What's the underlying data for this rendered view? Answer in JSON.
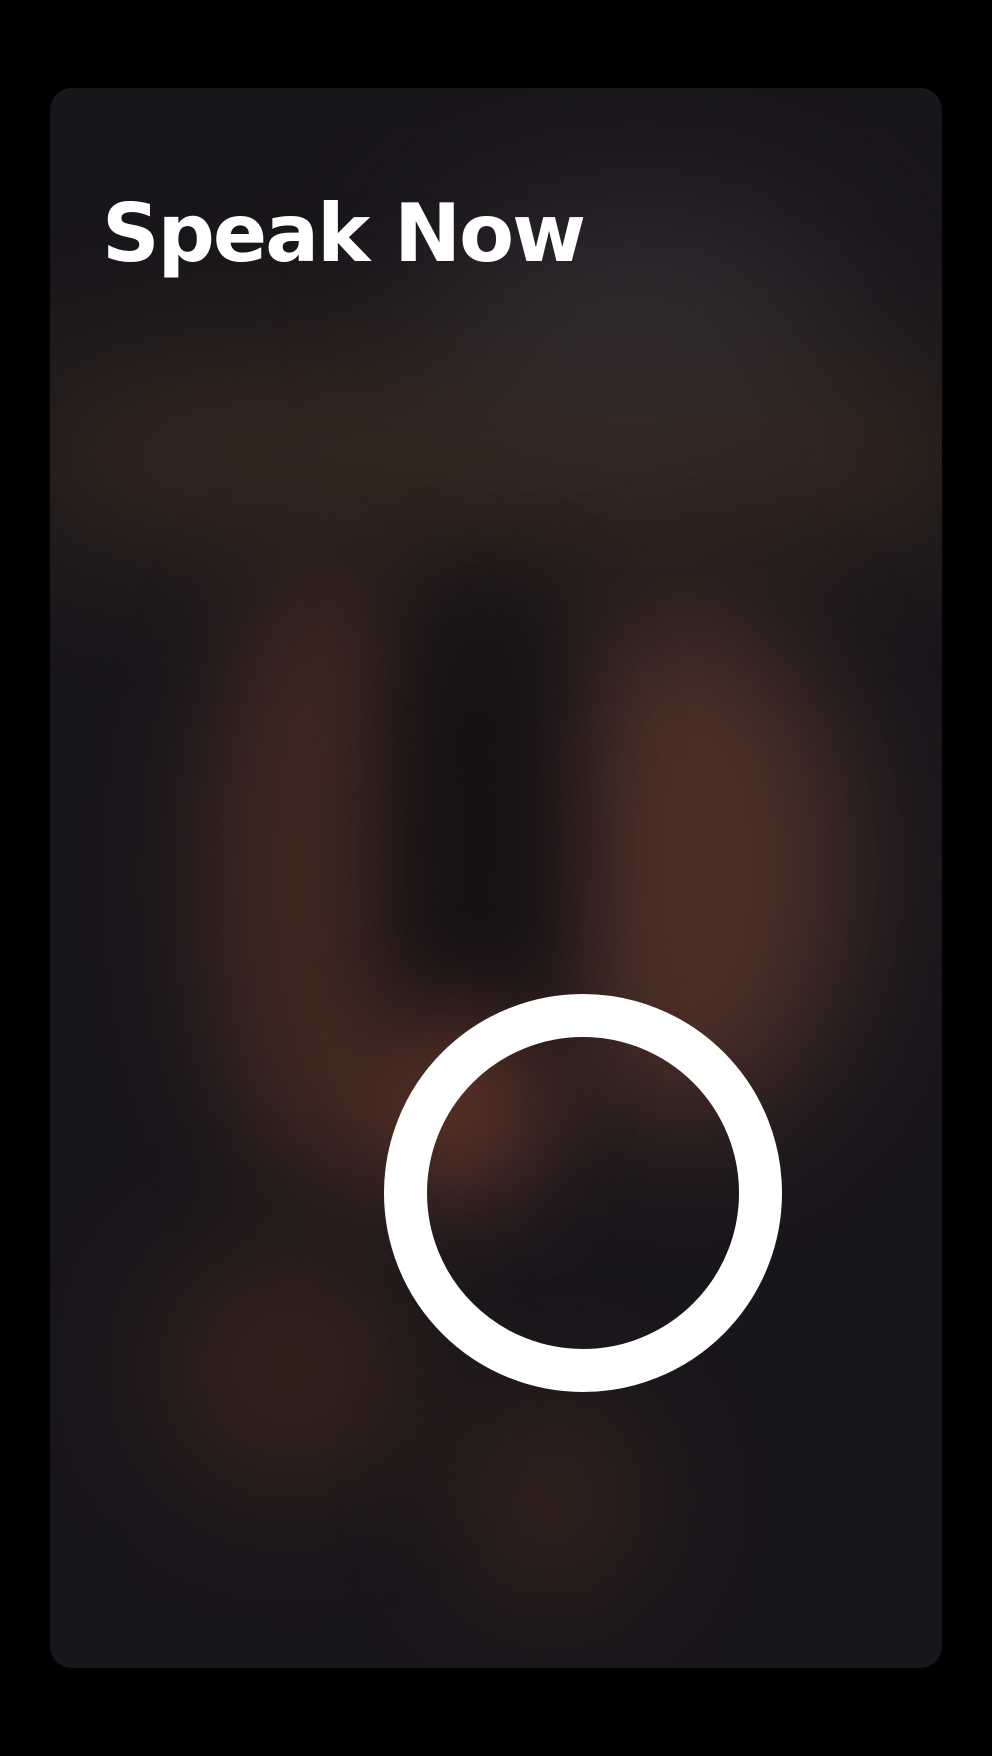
{
  "screen": {
    "title": "Speak Now"
  },
  "record_button": {
    "icon": "record-ring-icon",
    "color": "#ffffff"
  },
  "theme": {
    "background": "#000000",
    "panel": "#17141a"
  }
}
